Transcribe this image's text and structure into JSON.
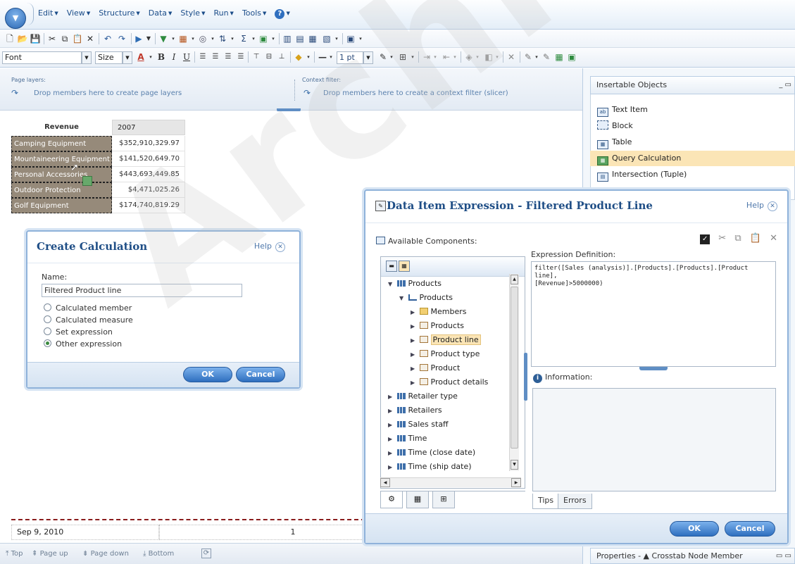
{
  "menu": {
    "items": [
      "Edit",
      "View",
      "Structure",
      "Data",
      "Style",
      "Run",
      "Tools"
    ]
  },
  "format_toolbar": {
    "font_label": "Font",
    "size_label": "Size",
    "line_width": "1 pt"
  },
  "layers": {
    "page_layers_label": "Page layers:",
    "page_layers_hint": "Drop members here to create page layers",
    "context_filter_label": "Context filter:",
    "context_filter_hint": "Drop members here to create a context filter (slicer)"
  },
  "crosstab": {
    "row_header": "Revenue",
    "column_header": "2007",
    "rows": [
      {
        "member": "Camping Equipment",
        "value": "$352,910,329.97"
      },
      {
        "member": "Mountaineering Equipment",
        "value": "$141,520,649.70"
      },
      {
        "member": "Personal Accessories",
        "value": "$443,693,449.85"
      },
      {
        "member": "Outdoor Protection",
        "value": "$4,471,025.26"
      },
      {
        "member": "Golf Equipment",
        "value": "$174,740,819.29"
      }
    ]
  },
  "report_footer": {
    "date": "Sep 9, 2010",
    "page_number": "1"
  },
  "statusbar": {
    "items": [
      "Top",
      "Page up",
      "Page down",
      "Bottom"
    ]
  },
  "insertable": {
    "title": "Insertable Objects",
    "items": [
      {
        "label": "Text Item",
        "icon": "ab"
      },
      {
        "label": "Block",
        "icon": "blk"
      },
      {
        "label": "Table",
        "icon": "tbl"
      },
      {
        "label": "Query Calculation",
        "icon": "qc"
      },
      {
        "label": "Intersection (Tuple)",
        "icon": "int"
      }
    ],
    "selected_index": 3
  },
  "properties": {
    "title": "Properties - ▲ Crosstab Node Member"
  },
  "create_calc": {
    "title": "Create Calculation",
    "help": "Help",
    "name_label": "Name:",
    "name_value": "Filtered Product line",
    "options": [
      "Calculated member",
      "Calculated measure",
      "Set expression",
      "Other expression"
    ],
    "selected_option": "Other expression",
    "ok": "OK",
    "cancel": "Cancel"
  },
  "expr_dialog": {
    "title": "Data Item Expression - Filtered Product Line",
    "help": "Help",
    "available_label": "Available Components:",
    "tree": [
      {
        "label": "Products",
        "icon": "dim",
        "level": 0,
        "expanded": true
      },
      {
        "label": "Products",
        "icon": "hier",
        "level": 1,
        "expanded": true
      },
      {
        "label": "Members",
        "icon": "folder",
        "level": 2,
        "expanded": false
      },
      {
        "label": "Products",
        "icon": "level",
        "level": 2,
        "expanded": false
      },
      {
        "label": "Product line",
        "icon": "level",
        "level": 2,
        "expanded": false,
        "selected": true
      },
      {
        "label": "Product type",
        "icon": "level",
        "level": 2,
        "expanded": false
      },
      {
        "label": "Product",
        "icon": "level",
        "level": 2,
        "expanded": false
      },
      {
        "label": "Product details",
        "icon": "level",
        "level": 2,
        "expanded": false
      },
      {
        "label": "Retailer type",
        "icon": "dim",
        "level": 0,
        "expanded": false
      },
      {
        "label": "Retailers",
        "icon": "dim",
        "level": 0,
        "expanded": false
      },
      {
        "label": "Sales staff",
        "icon": "dim",
        "level": 0,
        "expanded": false
      },
      {
        "label": "Time",
        "icon": "dim",
        "level": 0,
        "expanded": false
      },
      {
        "label": "Time (close date)",
        "icon": "dim",
        "level": 0,
        "expanded": false
      },
      {
        "label": "Time (ship date)",
        "icon": "dim",
        "level": 0,
        "expanded": false
      }
    ],
    "expression_label": "Expression Definition:",
    "expression_line1": "filter([Sales (analysis)].[Products].[Products].[Product line],",
    "expression_line2": "[Revenue]>5000000)",
    "information_label": "Information:",
    "tabs": [
      "Tips",
      "Errors"
    ],
    "ok": "OK",
    "cancel": "Cancel"
  }
}
